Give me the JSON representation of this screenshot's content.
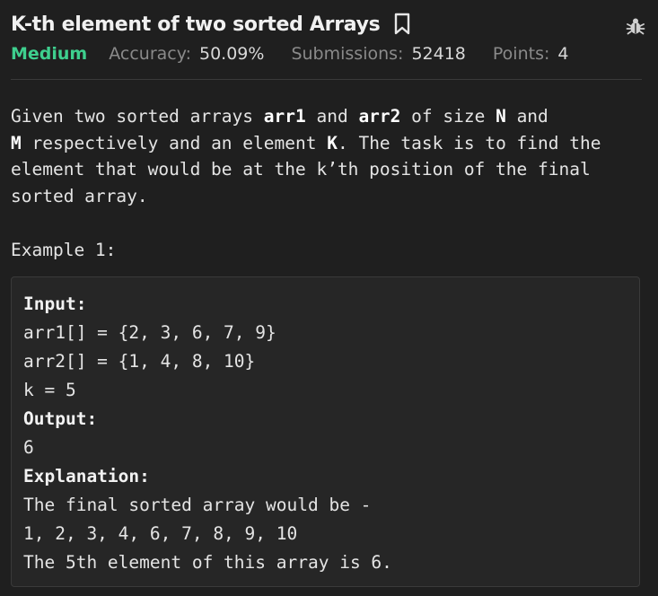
{
  "problem": {
    "title": "K-th element of two sorted Arrays",
    "difficulty": "Medium",
    "accuracy_label": "Accuracy:",
    "accuracy_value": "50.09%",
    "submissions_label": "Submissions:",
    "submissions_value": "52418",
    "points_label": "Points:",
    "points_value": "4"
  },
  "description": {
    "t1": "Given two sorted arrays ",
    "b1": "arr1",
    "t2": " and ",
    "b2": "arr2",
    "t3": " of size ",
    "b3": "N",
    "t4": " and",
    "b4": "M",
    "t5": " respectively and an element ",
    "b5": "K",
    "t6": ". The task is to find the",
    "line3": "element that would be at the k’th position of the final",
    "line4": "sorted array."
  },
  "example": {
    "heading": "Example 1:",
    "input_label": "Input:",
    "input_lines": [
      "arr1[] = {2, 3, 6, 7, 9}",
      "arr2[] = {1, 4, 8, 10}",
      "k = 5"
    ],
    "output_label": "Output:",
    "output_value": "6",
    "explanation_label": "Explanation:",
    "explanation_lines": [
      "The final sorted array would be -",
      "1, 2, 3, 4, 6, 7, 8, 9, 10",
      "The 5th element of this array is 6."
    ]
  },
  "icons": {
    "bookmark": "bookmark-icon",
    "bug": "bug-icon"
  },
  "colors": {
    "background": "#1f1f1f",
    "difficulty_medium": "#3ecf8e",
    "muted_label": "#8a8a8a",
    "example_bg": "#262626"
  }
}
